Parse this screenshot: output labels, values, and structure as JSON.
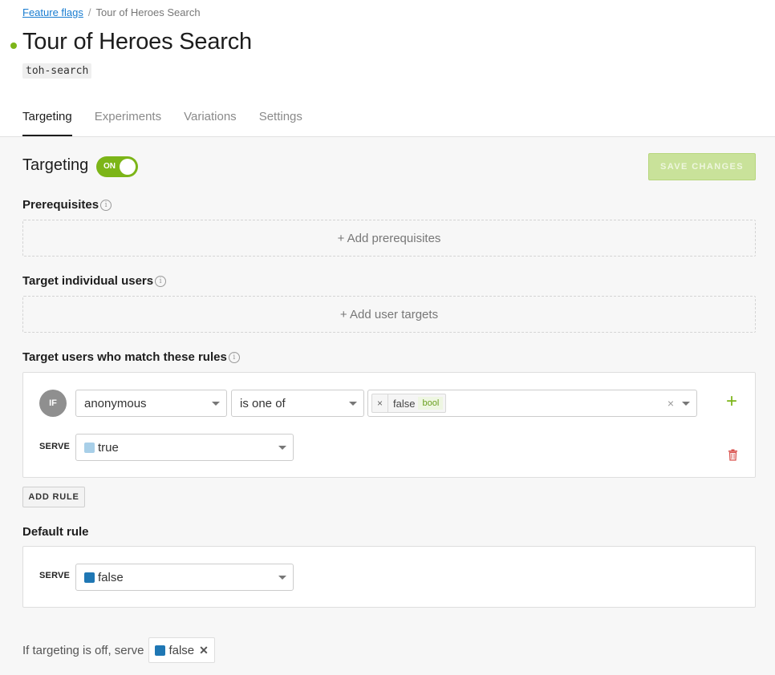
{
  "breadcrumb": {
    "parent": "Feature flags",
    "separator": "/",
    "current": "Tour of Heroes Search"
  },
  "flag": {
    "name": "Tour of Heroes Search",
    "key": "toh-search",
    "status_color": "#7cb518"
  },
  "tabs": [
    {
      "label": "Targeting",
      "active": true
    },
    {
      "label": "Experiments",
      "active": false
    },
    {
      "label": "Variations",
      "active": false
    },
    {
      "label": "Settings",
      "active": false
    }
  ],
  "targeting": {
    "title": "Targeting",
    "toggle_label": "ON",
    "toggle_on": true,
    "save_label": "SAVE CHANGES"
  },
  "prerequisites": {
    "title": "Prerequisites",
    "add_label": "+ Add prerequisites"
  },
  "individual": {
    "title": "Target individual users",
    "add_label": "+ Add user targets"
  },
  "rules": {
    "title": "Target users who match these rules",
    "if_label": "IF",
    "attribute": "anonymous",
    "operator": "is one of",
    "values": [
      {
        "value": "false",
        "type": "bool"
      }
    ],
    "clear_symbol": "×",
    "serve_label": "SERVE",
    "serve_value": "true",
    "serve_color": "#a8cfe8",
    "add_rule_label": "ADD RULE"
  },
  "default_rule": {
    "title": "Default rule",
    "serve_label": "SERVE",
    "serve_value": "false",
    "serve_color": "#1f77b4"
  },
  "off_variation": {
    "text": "If targeting is off, serve",
    "value": "false",
    "color": "#1f77b4",
    "remove_symbol": "✕"
  },
  "accent_color": "#7cb518"
}
